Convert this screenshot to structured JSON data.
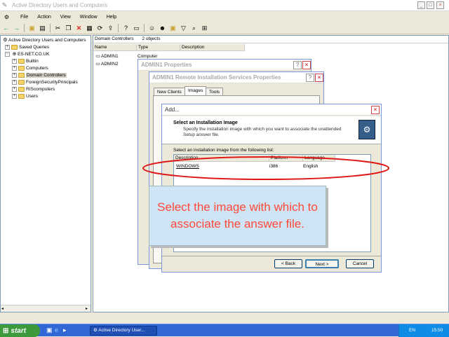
{
  "window": {
    "title": "Active Directory Users and Computers"
  },
  "menu": [
    "File",
    "Action",
    "View",
    "Window",
    "Help"
  ],
  "tree": {
    "root": "Active Directory Users and Computers",
    "items": [
      "Saved Queries",
      "ES-NET.CO.UK",
      "Builtin",
      "Computers",
      "Domain Controllers",
      "ForeignSecurityPrincipals",
      "RIScomputers",
      "Users"
    ]
  },
  "list": {
    "header_path": "Domain Controllers",
    "header_count": "2 objects",
    "columns": [
      "Name",
      "Type",
      "Description"
    ],
    "rows": [
      {
        "name": "ADMIN1",
        "type": "Computer"
      },
      {
        "name": "ADMIN2",
        "type": ""
      }
    ]
  },
  "props_dialog": {
    "title": "ADMIN1 Properties"
  },
  "ris_dialog": {
    "title": "ADMIN1 Remote Installation Services Properties",
    "tabs": [
      "New Clients",
      "Images",
      "Tools"
    ]
  },
  "add_dialog": {
    "title": "Add...",
    "heading": "Select an Installation Image",
    "description": "Specify the installation image with which you want to associate the unattended Setup answer file.",
    "list_label": "Select an installation image from the following list:",
    "columns": [
      "Description",
      "Platform",
      "Language"
    ],
    "rows": [
      {
        "description": "WINDOWS",
        "platform": "i386",
        "language": "English"
      }
    ],
    "buttons": {
      "back": "< Back",
      "next": "Next >",
      "cancel": "Cancel"
    }
  },
  "callout": {
    "text": "Select the image with which to associate the answer file."
  },
  "taskbar": {
    "start": "start",
    "task": "Active Directory User...",
    "lang": "EN",
    "clock": "15:50"
  },
  "colors": {
    "callout_text": "#ff4a3a",
    "callout_bg": "#cfe4f4",
    "highlight_ring": "#e01818",
    "taskbar": "#3168d5"
  }
}
